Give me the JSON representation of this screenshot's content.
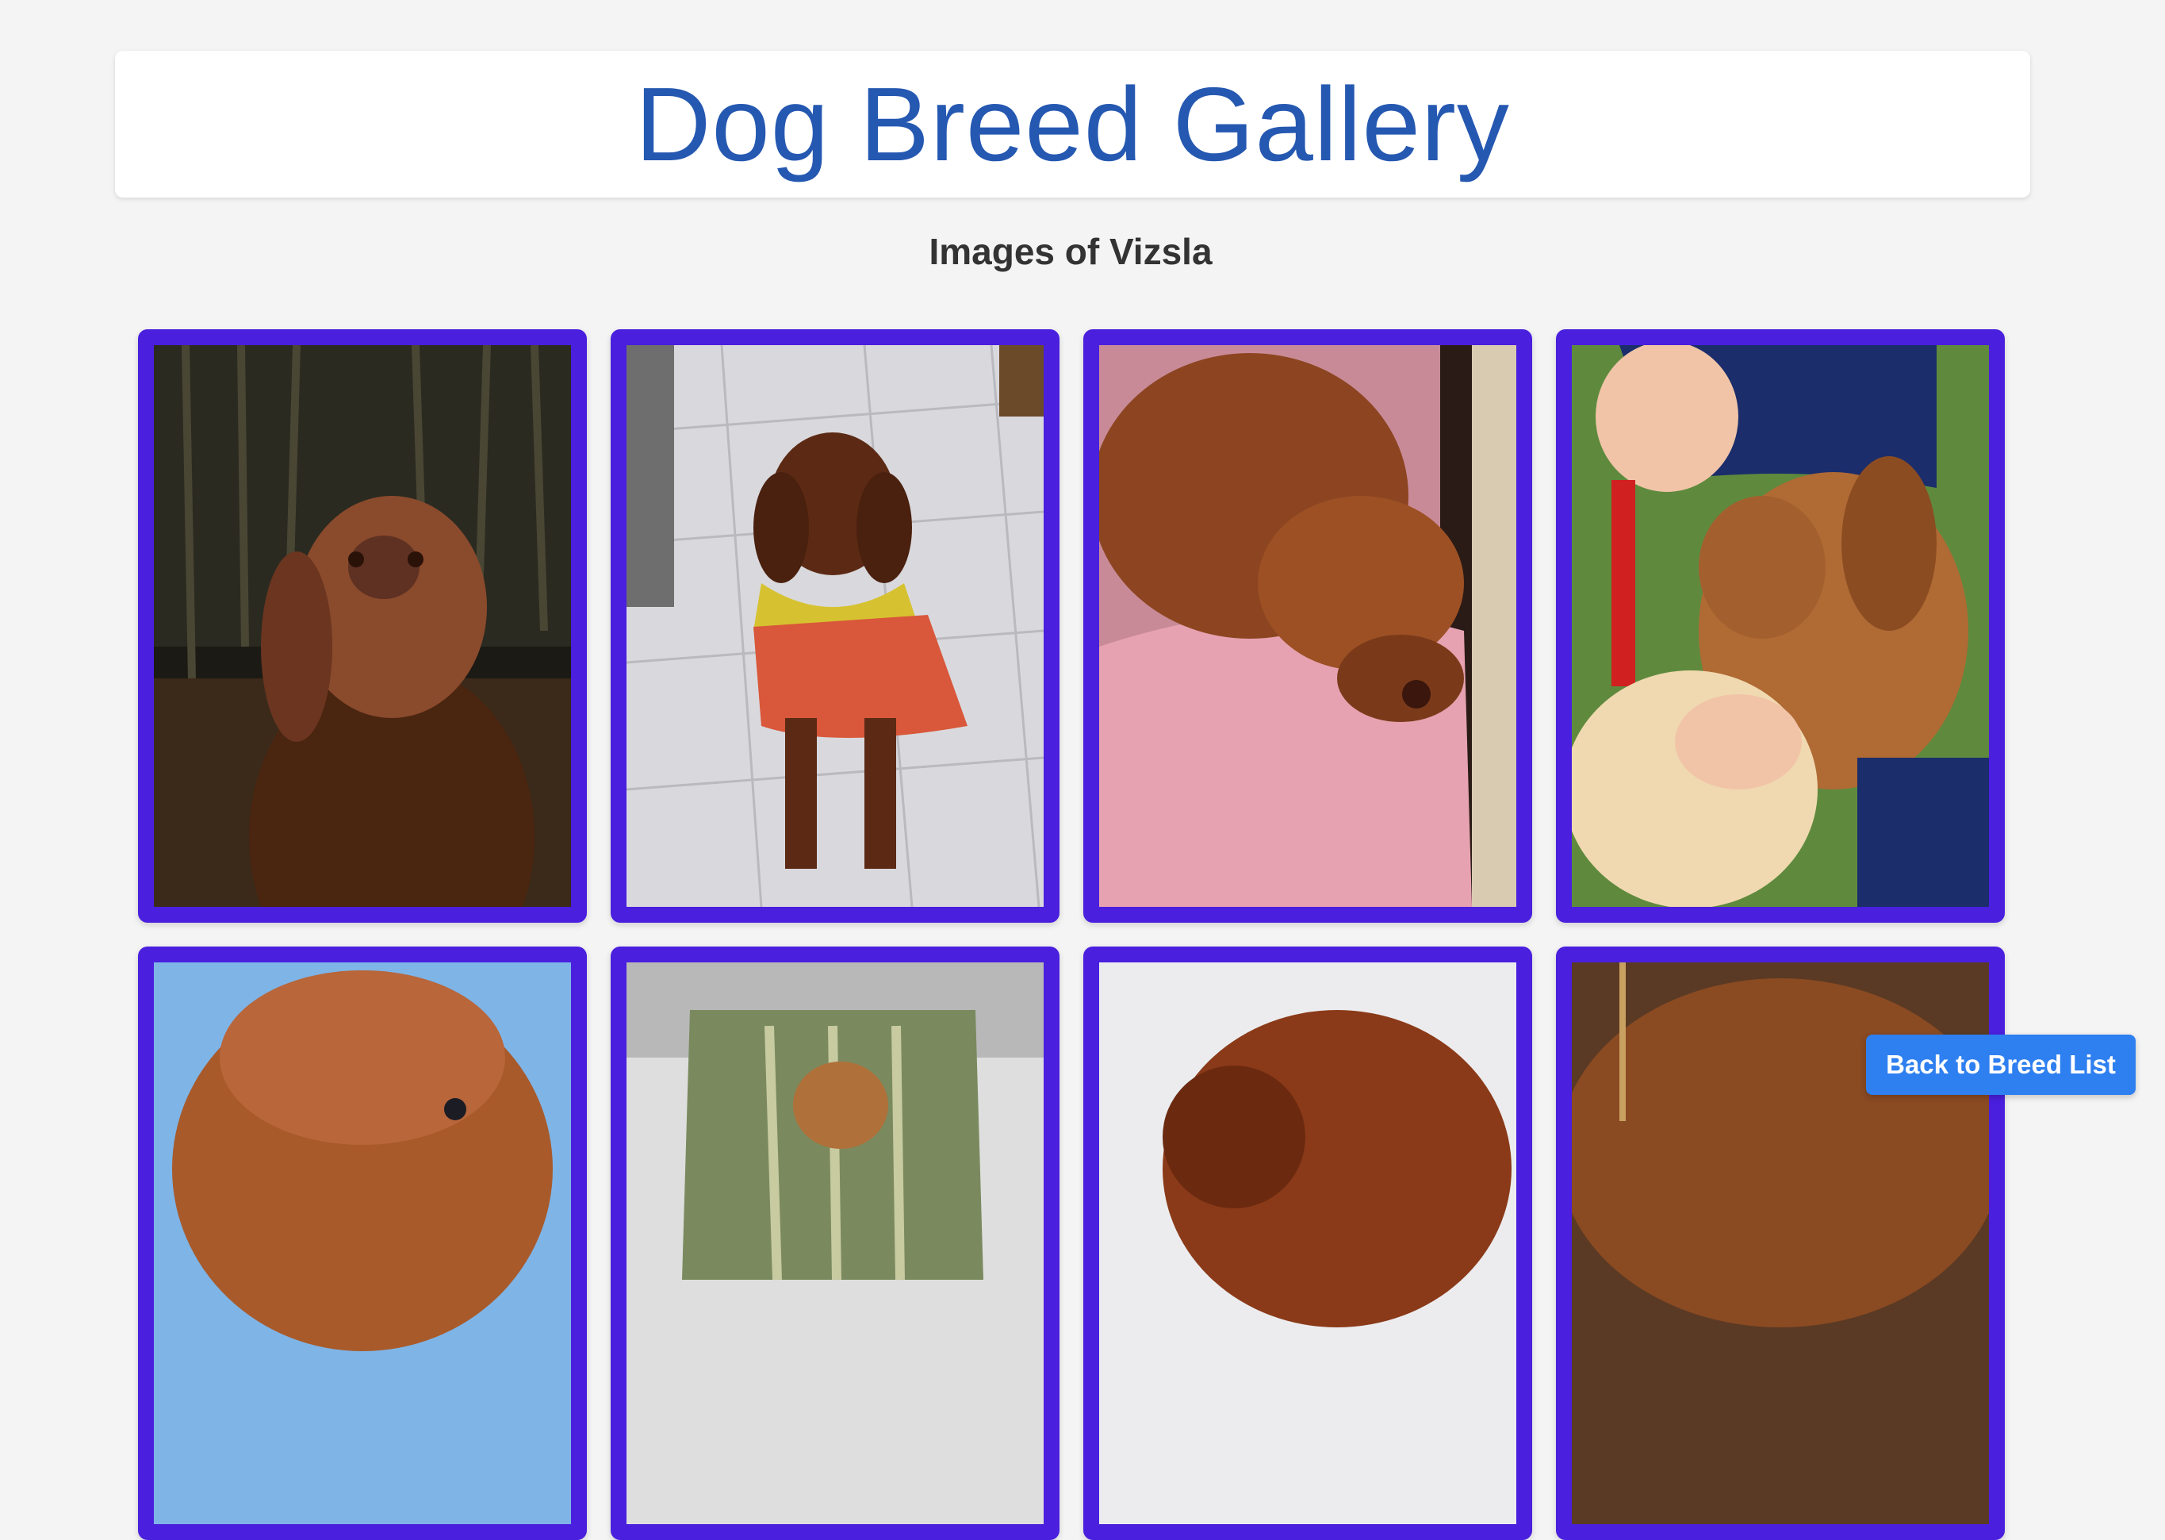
{
  "header": {
    "title": "Dog Breed Gallery"
  },
  "gallery": {
    "subtitle": "Images of Vizsla",
    "card_color": "#4a1fde",
    "images": [
      {
        "name": "vizsla-photo-1"
      },
      {
        "name": "vizsla-photo-2"
      },
      {
        "name": "vizsla-photo-3"
      },
      {
        "name": "vizsla-photo-4"
      },
      {
        "name": "vizsla-photo-5"
      },
      {
        "name": "vizsla-photo-6"
      },
      {
        "name": "vizsla-photo-7"
      },
      {
        "name": "vizsla-photo-8"
      }
    ]
  },
  "actions": {
    "back_label": "Back to Breed List",
    "back_color": "#2e7ff0"
  },
  "colors": {
    "title": "#2558b1",
    "background": "#f4f4f4"
  }
}
